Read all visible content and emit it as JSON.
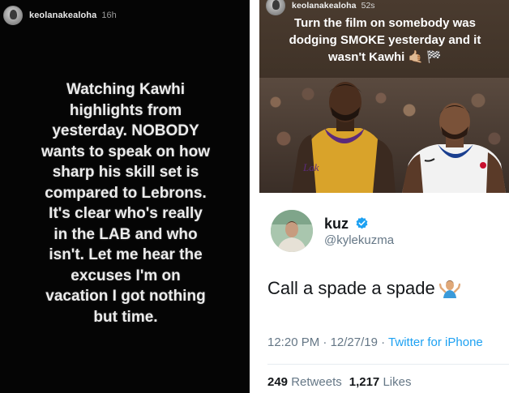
{
  "left_story": {
    "username": "keolanakealoha",
    "time": "16h",
    "text": "Watching Kawhi\nhighlights from\nyesterday. NOBODY\nwants to speak on how\nsharp his skill set is\ncompared to Lebrons.\nIt's clear who's really\nin the LAB and who\nisn't.  Let me hear the\nexcuses I'm on\nvacation I got nothing\nbut time."
  },
  "right_story": {
    "username": "keolanakealoha",
    "time": "52s",
    "caption_line1": "Turn the film on somebody was",
    "caption_line2": "dodging SMOKE yesterday and it",
    "caption_line3": "wasn't Kawhi 🤙🏼 🏁"
  },
  "tweet": {
    "name": "kuz",
    "handle": "@kylekuzma",
    "body": "Call a spade a spade",
    "time": "12:20 PM",
    "date": "12/27/19",
    "source": "Twitter for iPhone",
    "retweets_count": "249",
    "retweets_label": "Retweets",
    "likes_count": "1,217",
    "likes_label": "Likes"
  },
  "colors": {
    "story_bg": "#050505",
    "twitter_blue": "#1da1f2",
    "tweet_gray": "#657786"
  }
}
